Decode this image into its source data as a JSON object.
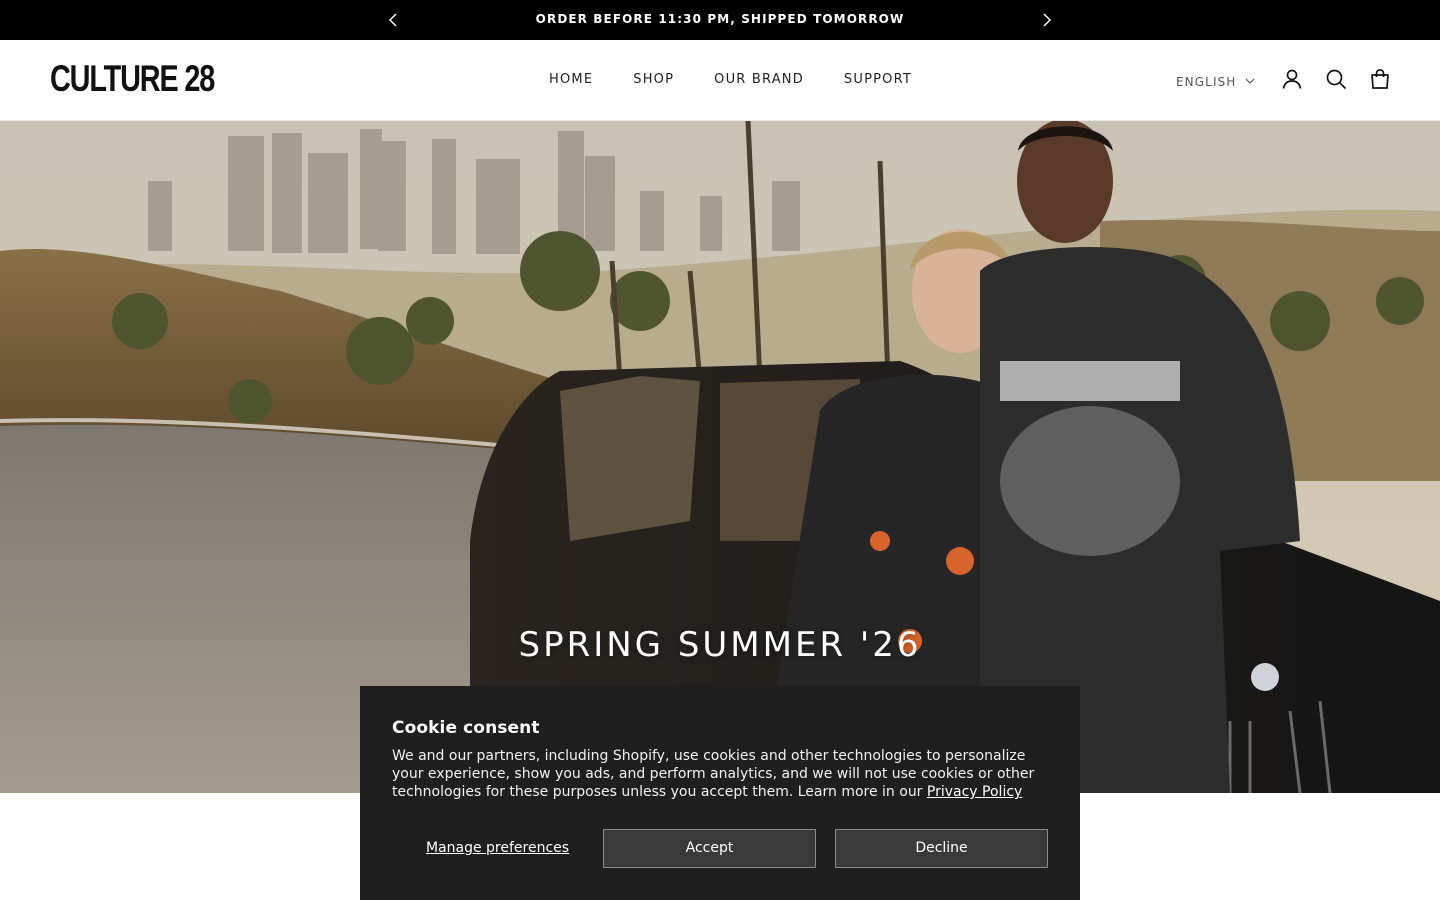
{
  "announcement": {
    "message": "ORDER BEFORE 11:30 PM, SHIPPED TOMORROW",
    "prev_icon": "chevron-left-icon",
    "next_icon": "chevron-right-icon"
  },
  "header": {
    "logo": "CULTURE 28",
    "nav": [
      "HOME",
      "SHOP",
      "OUR BRAND",
      "SUPPORT"
    ],
    "language": "ENGLISH",
    "icons": [
      "account-icon",
      "search-icon",
      "cart-icon"
    ]
  },
  "hero": {
    "title": "SPRING SUMMER '26",
    "image_alt": "Couple in graphic t-shirts leaning on a vintage black car on a hillside above the city skyline"
  },
  "cookie": {
    "title": "Cookie consent",
    "body": "We and our partners, including Shopify, use cookies and other technologies to personalize your experience, show you ads, and perform analytics, and we will not use cookies or other technologies for these purposes unless you accept them. Learn more in our ",
    "privacy_link": "Privacy Policy",
    "manage_label": "Manage preferences",
    "accept_label": "Accept",
    "decline_label": "Decline"
  },
  "colors": {
    "announcement_bg": "#000000",
    "cookie_bg": "#1f1f1f",
    "text_dark": "#111111"
  }
}
